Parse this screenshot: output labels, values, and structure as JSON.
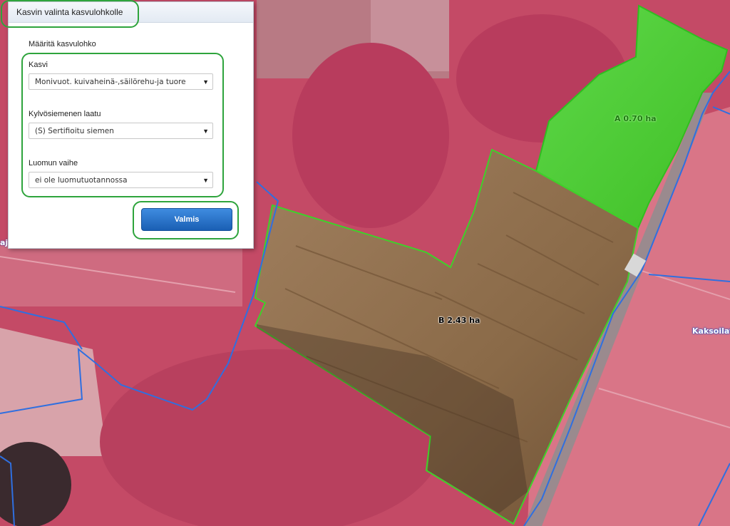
{
  "dialog": {
    "title": "Kasvin valinta kasvulohkolle",
    "section_title": "Määritä kasvulohko",
    "fields": [
      {
        "label": "Kasvi",
        "value": "Monivuot. kuivaheinä-,säilörehu-ja tuore"
      },
      {
        "label": "Kylvösiemenen laatu",
        "value": "(S) Sertifioitu siemen"
      },
      {
        "label": "Luomun vaihe",
        "value": "ei ole luomutuotannossa"
      }
    ],
    "submit_label": "Valmis"
  },
  "map": {
    "parcels": [
      {
        "label": "A 0.70 ha",
        "color": "#4cc92f"
      },
      {
        "label": "B 2.43 ha",
        "color": "#8a6a48"
      }
    ],
    "place_label": "Kaksoilato",
    "edge_label": "aj",
    "boundary_color": "#2f6fe0",
    "parcel_outline_color": "#3fd12a"
  },
  "icons": {
    "dropdown": "chevron-down-icon"
  }
}
